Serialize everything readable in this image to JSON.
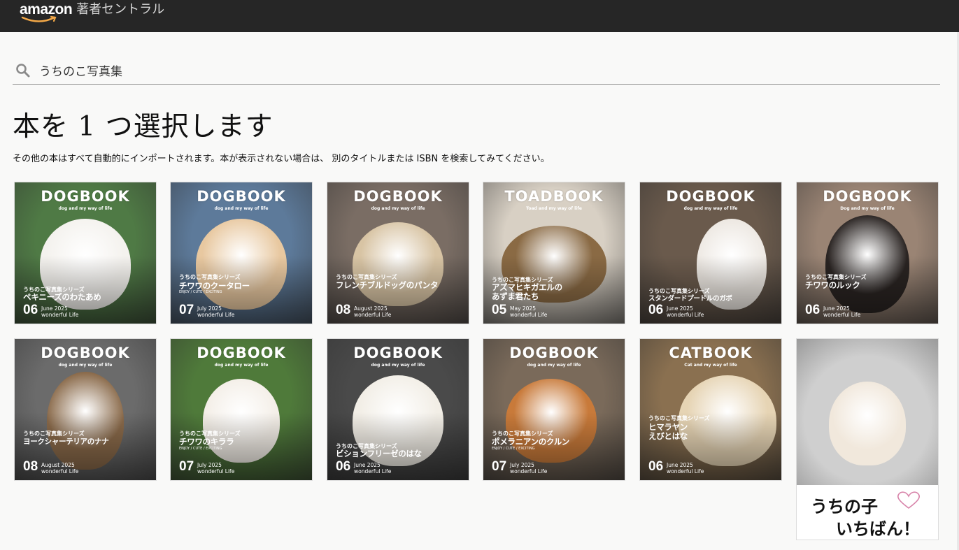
{
  "header": {
    "logo_word": "amazon",
    "logo_sub": "著者セントラル"
  },
  "search": {
    "value": "うちのこ写真集",
    "placeholder": ""
  },
  "main": {
    "title": "本を 1 つ選択します",
    "subtitle": "その他の本はすべて自動的にインポートされます。本が表示されない場合は、 別のタイトルまたは ISBN を検索してみてください。"
  },
  "colors": {
    "header_bg": "#262626",
    "page_bg": "#f9f9f8"
  },
  "books": [
    {
      "brand": "DOGBOOK",
      "tagline": "dog and my way of life",
      "series": "うちのこ写真集シリーズ",
      "name": "ペキニーズのわたあめ",
      "enjoy": "",
      "num": "06",
      "month": "June 2025",
      "sub": "wonderful Life",
      "bg": "#4f7a45",
      "subject": "#f4f2ee"
    },
    {
      "brand": "DOGBOOK",
      "tagline": "dog and my way of life",
      "series": "うちのこ写真集シリーズ",
      "name": "チワワのクータロー",
      "enjoy": "ENJOY / CUTE / EXCITING",
      "num": "07",
      "month": "July 2025",
      "sub": "wonderful Life",
      "bg": "#5d7a9a",
      "subject": "#e8c8a0"
    },
    {
      "brand": "DOGBOOK",
      "tagline": "dog and my way of life",
      "series": "うちのこ写真集シリーズ",
      "name": "フレンチブルドッグのパンタ",
      "enjoy": "",
      "num": "08",
      "month": "August 2025",
      "sub": "wonderful Life",
      "bg": "#7a6d64",
      "subject": "#d8c4a4"
    },
    {
      "brand": "TOADBOOK",
      "tagline": "Toad and my way of life",
      "series": "うちのこ写真集シリーズ",
      "name": "アズマヒキガエルのあずま君たち",
      "enjoy": "",
      "num": "05",
      "month": "May 2025",
      "sub": "wonderful Life",
      "bg": "#d8d0c4",
      "subject": "#8a6a44"
    },
    {
      "brand": "DOGBOOK",
      "tagline": "dog and my way of life",
      "series": "うちのこ写真集シリーズ",
      "name": "スタンダードプードルのガボ",
      "enjoy": "",
      "num": "06",
      "month": "June 2025",
      "sub": "wonderful Life",
      "bg": "#6a5a4c",
      "subject": "#ede8e2"
    },
    {
      "brand": "DOGBOOK",
      "tagline": "Dog and my way of life",
      "series": "うちのこ写真集シリーズ",
      "name": "チワワのルック",
      "enjoy": "",
      "num": "06",
      "month": "June 2025",
      "sub": "wonderful Life",
      "bg": "#9a8474",
      "subject": "#2a2422"
    },
    {
      "brand": "DOGBOOK",
      "tagline": "dog and my way of life",
      "series": "うちのこ写真集シリーズ",
      "name": "ヨークシャーテリアのナナ",
      "enjoy": "",
      "num": "08",
      "month": "August 2025",
      "sub": "wonderful Life",
      "bg": "#6b6b6b",
      "subject": "#8a6a4a"
    },
    {
      "brand": "DOGBOOK",
      "tagline": "dog and my way of life",
      "series": "うちのこ写真集シリーズ",
      "name": "チワワのキララ",
      "enjoy": "ENJOY / CUTE / EXCITING",
      "num": "07",
      "month": "July 2025",
      "sub": "wonderful Life",
      "bg": "#4f7a3a",
      "subject": "#f4efe8"
    },
    {
      "brand": "DOGBOOK",
      "tagline": "dog and my way of life",
      "series": "うちのこ写真集シリーズ",
      "name": "ビションフリーゼのはな",
      "enjoy": "",
      "num": "06",
      "month": "June 2025",
      "sub": "wonderful Life",
      "bg": "#4a4a4a",
      "subject": "#f2eee6"
    },
    {
      "brand": "DOGBOOK",
      "tagline": "dog and my way of life",
      "series": "うちのこ写真集シリーズ",
      "name": "ポメラニアンのクルン",
      "enjoy": "ENJOY / CUTE / EXCITING",
      "num": "07",
      "month": "July 2025",
      "sub": "wonderful Life",
      "bg": "#7a6a5a",
      "subject": "#c87a3a"
    },
    {
      "brand": "CATBOOK",
      "tagline": "Cat and my way of life",
      "series": "うちのこ写真集シリーズ",
      "name": "ヒマラヤン えびとはな",
      "enjoy": "",
      "num": "06",
      "month": "June 2025",
      "sub": "wonderful Life",
      "bg": "#8a7050",
      "subject": "#e6d4b4"
    }
  ],
  "special_book": {
    "line1": "うちの子",
    "line2": "いちばん！",
    "bg": "#cfcfcf",
    "subject": "#f1e8dc"
  }
}
